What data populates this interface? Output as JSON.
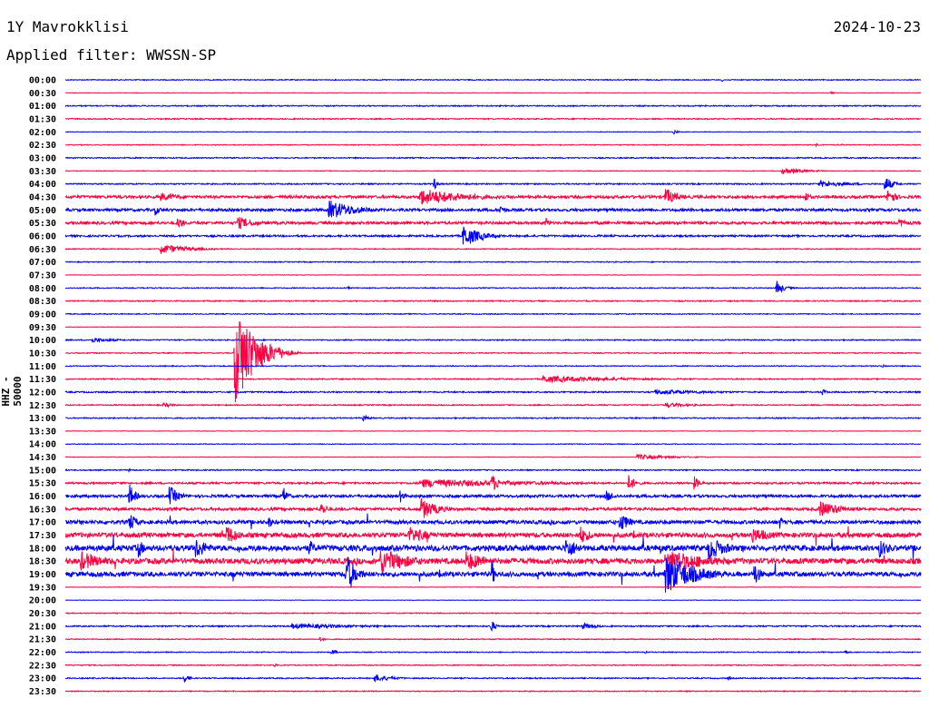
{
  "header": {
    "station": "1Y Mavrokklisi",
    "date": "2024-10-23",
    "filter": "Applied filter: WWSSN-SP"
  },
  "chart_data": {
    "type": "line",
    "title": "1Y Mavrokklisi",
    "ylabel": "HHZ - 50000",
    "row_minutes": 30,
    "colors": {
      "even": "#0000ff",
      "odd": "#ff0040"
    },
    "rows": [
      {
        "label": "00:00",
        "noise": 1,
        "events": [
          [
            23.0,
            0.2,
            4
          ]
        ]
      },
      {
        "label": "00:30",
        "noise": 0.5,
        "events": [
          [
            26.8,
            0.2,
            4
          ]
        ]
      },
      {
        "label": "01:00",
        "noise": 1.2,
        "events": []
      },
      {
        "label": "01:30",
        "noise": 1.2,
        "events": []
      },
      {
        "label": "02:00",
        "noise": 0.6,
        "events": [
          [
            21.3,
            0.3,
            4
          ]
        ]
      },
      {
        "label": "02:30",
        "noise": 0.9,
        "events": [
          [
            26.3,
            0.2,
            4
          ],
          [
            27.2,
            0.1,
            6
          ]
        ]
      },
      {
        "label": "03:00",
        "noise": 1.2,
        "events": []
      },
      {
        "label": "03:30",
        "noise": 0.7,
        "events": [
          [
            25.1,
            1.9,
            4
          ]
        ]
      },
      {
        "label": "04:00",
        "noise": 1.4,
        "events": [
          [
            26.4,
            3,
            4
          ],
          [
            28.7,
            0.6,
            12
          ],
          [
            12.9,
            0.2,
            14
          ]
        ]
      },
      {
        "label": "04:30",
        "noise": 3,
        "events": [
          [
            3.3,
            2,
            5
          ],
          [
            12.4,
            4,
            10
          ],
          [
            21,
            1,
            12
          ],
          [
            25.9,
            0.5,
            8
          ],
          [
            28.8,
            0.6,
            14
          ]
        ]
      },
      {
        "label": "05:00",
        "noise": 3,
        "events": [
          [
            3.1,
            0.5,
            8
          ],
          [
            9.2,
            2.3,
            12
          ],
          [
            15.2,
            0.5,
            8
          ]
        ]
      },
      {
        "label": "05:30",
        "noise": 3,
        "events": [
          [
            3.9,
            0.5,
            10
          ],
          [
            6,
            1.6,
            8
          ],
          [
            16.8,
            0.3,
            10
          ],
          [
            29.2,
            0.8,
            6
          ]
        ]
      },
      {
        "label": "06:00",
        "noise": 2,
        "events": [
          [
            13.9,
            1.5,
            14
          ],
          [
            18.7,
            0.2,
            4
          ]
        ]
      },
      {
        "label": "06:30",
        "noise": 1,
        "events": [
          [
            3.3,
            2.4,
            6
          ]
        ]
      },
      {
        "label": "07:00",
        "noise": 1,
        "events": []
      },
      {
        "label": "07:30",
        "noise": 0.5,
        "events": []
      },
      {
        "label": "08:00",
        "noise": 1,
        "events": [
          [
            24.9,
            0.6,
            10
          ],
          [
            9.9,
            0.1,
            6
          ]
        ]
      },
      {
        "label": "08:30",
        "noise": 1.2,
        "events": []
      },
      {
        "label": "09:00",
        "noise": 1,
        "events": []
      },
      {
        "label": "09:30",
        "noise": 0.5,
        "events": []
      },
      {
        "label": "10:00",
        "noise": 1.2,
        "events": [
          [
            0.9,
            2,
            3
          ]
        ]
      },
      {
        "label": "10:30",
        "noise": 1,
        "events": [
          [
            5.9,
            1.8,
            62
          ]
        ]
      },
      {
        "label": "11:00",
        "noise": 1,
        "events": [
          [
            28.6,
            0.3,
            4
          ]
        ]
      },
      {
        "label": "11:30",
        "noise": 1.2,
        "events": [
          [
            16.7,
            6.9,
            4
          ]
        ]
      },
      {
        "label": "12:00",
        "noise": 1.5,
        "events": [
          [
            20.6,
            5.7,
            3
          ],
          [
            26.5,
            0.4,
            5
          ]
        ]
      },
      {
        "label": "12:30",
        "noise": 1.2,
        "events": [
          [
            3.4,
            1,
            3
          ],
          [
            21,
            2.3,
            3
          ]
        ]
      },
      {
        "label": "13:00",
        "noise": 1.2,
        "events": [
          [
            10.4,
            0.5,
            5
          ]
        ]
      },
      {
        "label": "13:30",
        "noise": 0.5,
        "events": []
      },
      {
        "label": "14:00",
        "noise": 0.8,
        "events": []
      },
      {
        "label": "14:30",
        "noise": 0.5,
        "events": [
          [
            20,
            3.2,
            3
          ]
        ]
      },
      {
        "label": "15:00",
        "noise": 1.2,
        "events": [
          [
            2.2,
            0.2,
            4
          ]
        ]
      },
      {
        "label": "15:30",
        "noise": 2,
        "events": [
          [
            12.4,
            10.2,
            5
          ],
          [
            14.9,
            0.6,
            14
          ],
          [
            19.7,
            0.6,
            12
          ],
          [
            22,
            0.5,
            10
          ]
        ]
      },
      {
        "label": "16:00",
        "noise": 3,
        "events": [
          [
            2.2,
            0.5,
            18
          ],
          [
            3.6,
            0.8,
            14
          ],
          [
            7.6,
            0.4,
            14
          ],
          [
            11.7,
            0.4,
            10
          ],
          [
            18.9,
            0.8,
            8
          ]
        ]
      },
      {
        "label": "16:30",
        "noise": 3,
        "events": [
          [
            8.9,
            0.6,
            10
          ],
          [
            12.4,
            1.4,
            14
          ],
          [
            26.4,
            2,
            10
          ]
        ]
      },
      {
        "label": "17:00",
        "noise": 4,
        "events": [
          [
            2.2,
            0.6,
            14
          ],
          [
            7.1,
            0.4,
            10
          ],
          [
            19.4,
            0.8,
            14
          ],
          [
            25,
            0.4,
            10
          ]
        ]
      },
      {
        "label": "17:30",
        "noise": 5,
        "events": [
          [
            5.6,
            1,
            14
          ],
          [
            12,
            2,
            10
          ],
          [
            18,
            1,
            12
          ],
          [
            24,
            2,
            10
          ]
        ]
      },
      {
        "label": "18:00",
        "noise": 6,
        "events": [
          [
            2.5,
            0.6,
            14
          ],
          [
            4.5,
            1.2,
            14
          ],
          [
            8.5,
            0.6,
            12
          ],
          [
            17.5,
            1.2,
            14
          ],
          [
            22.5,
            1.5,
            16
          ],
          [
            28.5,
            1,
            12
          ]
        ]
      },
      {
        "label": "18:30",
        "noise": 6,
        "events": [
          [
            0.5,
            2,
            12
          ],
          [
            11,
            2.5,
            16
          ],
          [
            14,
            2,
            12
          ],
          [
            21,
            4,
            14
          ]
        ]
      },
      {
        "label": "19:00",
        "noise": 5,
        "events": [
          [
            9.8,
            0.8,
            30
          ],
          [
            14.9,
            0.3,
            25
          ],
          [
            21,
            2.5,
            25
          ],
          [
            24.1,
            0.5,
            20
          ]
        ]
      },
      {
        "label": "19:30",
        "noise": 0.5,
        "events": []
      },
      {
        "label": "20:00",
        "noise": 0.5,
        "events": []
      },
      {
        "label": "20:30",
        "noise": 1,
        "events": []
      },
      {
        "label": "21:00",
        "noise": 1.5,
        "events": [
          [
            7.9,
            6.7,
            3
          ],
          [
            14.9,
            0.3,
            12
          ],
          [
            18.1,
            1.3,
            4
          ]
        ]
      },
      {
        "label": "21:30",
        "noise": 1,
        "events": [
          [
            8.9,
            0.3,
            5
          ]
        ]
      },
      {
        "label": "22:00",
        "noise": 1,
        "events": [
          [
            9.3,
            0.4,
            5
          ],
          [
            20.3,
            0.1,
            8
          ],
          [
            27.3,
            0.2,
            6
          ]
        ]
      },
      {
        "label": "22:30",
        "noise": 1,
        "events": [
          [
            7.3,
            0.2,
            4
          ]
        ]
      },
      {
        "label": "23:00",
        "noise": 1.2,
        "events": [
          [
            4.1,
            0.5,
            7
          ],
          [
            10.8,
            1.5,
            5
          ],
          [
            23.2,
            0.2,
            5
          ]
        ]
      },
      {
        "label": "23:30",
        "noise": 1,
        "events": []
      }
    ]
  }
}
